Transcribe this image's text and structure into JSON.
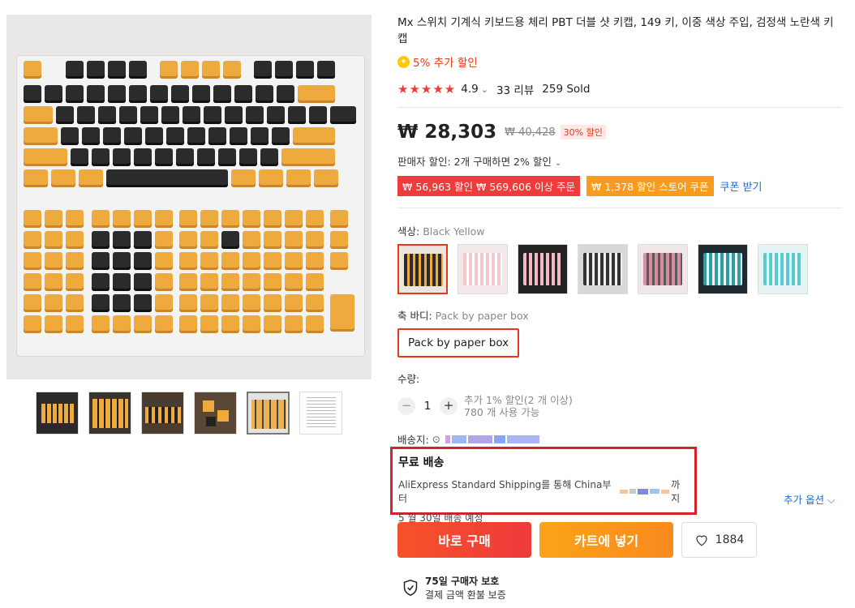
{
  "product": {
    "title": "Mx 스위치 기계식 키보드용 체리 PBT 더블 샷 키캡, 149 키, 이중 색상 주입, 검정색 노란색 키캡",
    "extra_discount": "5% 추가 할인",
    "rating": "4.9",
    "rating_chevron": "⌄",
    "reviews": "33 리뷰",
    "sold": "259 Sold",
    "price": "₩ 28,303",
    "original_price": "₩ 40,428",
    "discount_badge": "30% 할인",
    "seller_discount": "판매자 할인: 2개 구매하면 2% 할인",
    "seller_discount_chevron": "⌄",
    "coupon_1": "₩ 56,963 할인 ₩ 569,606 이상 주문",
    "coupon_2": "₩ 1,378 할인 스토어 쿠폰",
    "get_coupon": "쿠폰 받기"
  },
  "options": {
    "color_label": "색상:",
    "color_value": "Black Yellow",
    "body_label": "축 바디:",
    "body_value": "Pack by paper box",
    "body_button": "Pack by paper box"
  },
  "quantity": {
    "label": "수량:",
    "minus": "−",
    "value": "1",
    "plus": "+",
    "note_1": "추가 1% 할인(2 개 이상)",
    "note_2": "780 개 사용 가능"
  },
  "shipping": {
    "label": "배송지:",
    "free": "무료 배송",
    "line_prefix": "AliExpress Standard Shipping를 통해 China부터",
    "line_suffix": "까지",
    "date": "5 월 30일 배송 예정",
    "more_options": "추가 옵션 ⌵"
  },
  "actions": {
    "buy_now": "바로 구매",
    "add_to_cart": "카트에 넣기",
    "wishlist_count": "1884"
  },
  "protection": {
    "line_1": "75일 구매자 보호",
    "line_2": "결제 금액 환불 보증"
  },
  "colors": {
    "accent": "#e9371a",
    "link": "#1b6ed4",
    "highlight_box": "#d8232a"
  }
}
